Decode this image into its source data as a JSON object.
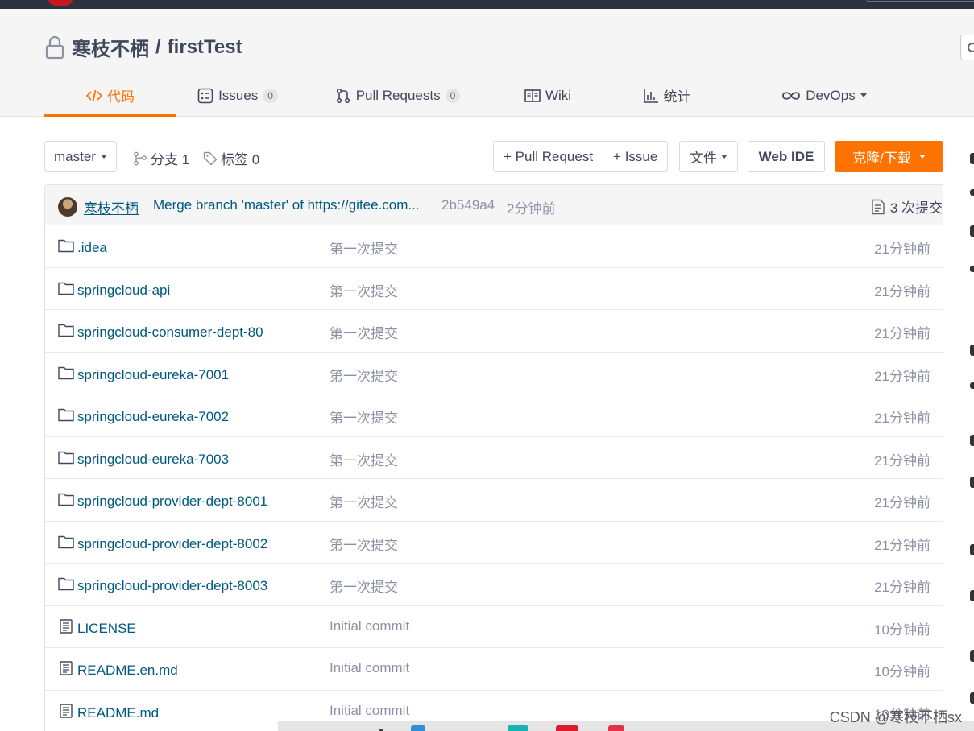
{
  "repo": {
    "owner": "寒枝不栖",
    "separator": "/",
    "name": "firstTest"
  },
  "tabs": [
    {
      "label": "代码",
      "active": true
    },
    {
      "label": "Issues",
      "count": "0"
    },
    {
      "label": "Pull Requests",
      "count": "0"
    },
    {
      "label": "Wiki"
    },
    {
      "label": "统计"
    },
    {
      "label": "DevOps"
    }
  ],
  "toolbar": {
    "branch": "master",
    "branches_label": "分支 1",
    "tags_label": "标签 0",
    "pull_request_label": "+ Pull Request",
    "issue_label": "+ Issue",
    "file_label": "文件",
    "webide_label": "Web IDE",
    "clone_label": "克隆/下载"
  },
  "last_commit": {
    "author": "寒枝不栖",
    "message": "Merge branch 'master' of https://gitee.com...",
    "sha": "2b549a4",
    "time": "2分钟前",
    "commit_count_label": "3 次提交"
  },
  "files": [
    {
      "name": ".idea",
      "type": "folder",
      "message": "第一次提交",
      "time": "21分钟前"
    },
    {
      "name": "springcloud-api",
      "type": "folder",
      "message": "第一次提交",
      "time": "21分钟前"
    },
    {
      "name": "springcloud-consumer-dept-80",
      "type": "folder",
      "message": "第一次提交",
      "time": "21分钟前"
    },
    {
      "name": "springcloud-eureka-7001",
      "type": "folder",
      "message": "第一次提交",
      "time": "21分钟前"
    },
    {
      "name": "springcloud-eureka-7002",
      "type": "folder",
      "message": "第一次提交",
      "time": "21分钟前"
    },
    {
      "name": "springcloud-eureka-7003",
      "type": "folder",
      "message": "第一次提交",
      "time": "21分钟前"
    },
    {
      "name": "springcloud-provider-dept-8001",
      "type": "folder",
      "message": "第一次提交",
      "time": "21分钟前"
    },
    {
      "name": "springcloud-provider-dept-8002",
      "type": "folder",
      "message": "第一次提交",
      "time": "21分钟前"
    },
    {
      "name": "springcloud-provider-dept-8003",
      "type": "folder",
      "message": "第一次提交",
      "time": "21分钟前"
    },
    {
      "name": "LICENSE",
      "type": "file",
      "message": "Initial commit",
      "time": "10分钟前"
    },
    {
      "name": "README.en.md",
      "type": "file",
      "message": "Initial commit",
      "time": "10分钟前"
    },
    {
      "name": "README.md",
      "type": "file",
      "message": "Initial commit",
      "time": "10分钟前"
    }
  ],
  "watermark": "CSDN @寒枝不栖sx",
  "colors": {
    "accent": "#fe7300",
    "link": "#005980",
    "muted": "#8c92a4",
    "topbar": "#2b3340"
  },
  "icons": {
    "folder": "folder-icon",
    "file": "file-icon",
    "lock": "lock-icon"
  }
}
